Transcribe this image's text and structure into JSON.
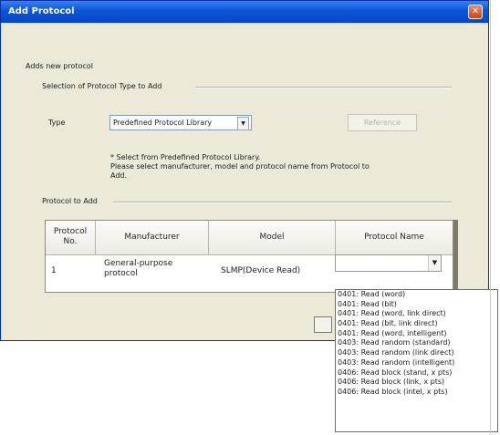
{
  "dialog": {
    "title": "Add Protocol",
    "description": "Adds new protocol",
    "selection_group": "Selection of Protocol Type to Add",
    "type_label": "Type",
    "type_value": "Predefined Protocol Library",
    "reference_button": "Reference",
    "note_lines": [
      "* Select from Predefined Protocol Library.",
      "Please select manufacturer, model and protocol name from Protocol to",
      "Add."
    ],
    "protocol_group": "Protocol to Add"
  },
  "table": {
    "headers": [
      "Protocol No.",
      "Manufacturer",
      "Model",
      "Protocol Name"
    ],
    "row": {
      "no": "1",
      "manufacturer_line1": "General-purpose",
      "manufacturer_line2": "protocol",
      "model": "SLMP(Device Read)",
      "protocol_name": ""
    }
  },
  "dropdown_options": [
    "0401: Read (word)",
    "0401: Read (bit)",
    "0401: Read (word, link direct)",
    "0401: Read (bit, link direct)",
    "0401: Read (word, intelligent)",
    "0403: Read random (standard)",
    "0403: Read random (link direct)",
    "0403: Read random (intelligent)",
    "0406: Read block (stand, x pts)",
    "0406: Read block (link, x pts)",
    "0406: Read block (intel, x pts)"
  ]
}
